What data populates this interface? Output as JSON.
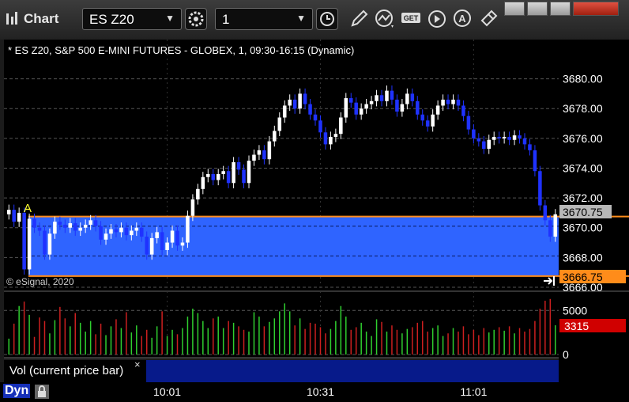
{
  "app_title": "Chart",
  "symbol_field": {
    "value": "ES Z20"
  },
  "interval_field": {
    "value": "1"
  },
  "toolbar_icons": [
    "settings-gear-icon",
    "clock-icon",
    "pencil-icon",
    "study-icon",
    "get-icon",
    "play-icon",
    "alert-icon",
    "link-icon"
  ],
  "window_buttons": [
    "help-icon",
    "restore-icon",
    "maximize-icon",
    "close-icon"
  ],
  "chart_header": "* ES Z20, S&P 500 E-MINI FUTURES - GLOBEX, 1, 09:30-16:15 (Dynamic)",
  "copyright": "© eSignal, 2020",
  "annotation_letter": "A",
  "volume_pane_label": "Vol (current price bar)",
  "volume_close_glyph": "×",
  "bottom_label": "Dyn",
  "price_ticks": [
    "3680.00",
    "3678.00",
    "3676.00",
    "3674.00",
    "3672.00",
    "3670.00",
    "3668.00",
    "3666.00"
  ],
  "volume_ticks": [
    "5000",
    "0"
  ],
  "time_ticks": [
    "10:01",
    "10:31",
    "11:01"
  ],
  "price_badge_upper": "3670.75",
  "price_badge_lower": "3666.75",
  "volume_badge": "3315",
  "colors": {
    "up_candle": "#ffffff",
    "down_candle": "#1f32ff",
    "zone_fill": "#2f64ff",
    "zone_border": "#ff8c1a",
    "volume_up": "#2fcf2f",
    "volume_down": "#cc1f1f",
    "badge_upper": "#b8b8b8",
    "badge_lower": "#ff8c1a",
    "badge_volume": "#d00000"
  },
  "chart_data": {
    "type": "candlestick",
    "title": "* ES Z20, S&P 500 E-MINI FUTURES - GLOBEX, 1, 09:30-16:15 (Dynamic)",
    "ylim": [
      3666,
      3681.2
    ],
    "volume_ylim": [
      0,
      7000
    ],
    "highlight_zone": [
      3666.75,
      3670.75
    ],
    "x_ticks": [
      {
        "label": "10:01",
        "bar_index": 31
      },
      {
        "label": "10:31",
        "bar_index": 61
      },
      {
        "label": "11:01",
        "bar_index": 91
      }
    ],
    "volume_current": 3315,
    "candle_closes": [
      3671.2,
      3670.4,
      3671.0,
      3667.2,
      3670.6,
      3670.0,
      3669.8,
      3668.2,
      3669.6,
      3670.4,
      3670.2,
      3670.0,
      3670.3,
      3669.8,
      3670.0,
      3670.2,
      3670.5,
      3670.1,
      3669.2,
      3669.6,
      3669.9,
      3669.7,
      3670.0,
      3669.5,
      3669.8,
      3670.0,
      3669.4,
      3668.2,
      3669.3,
      3669.7,
      3668.5,
      3669.0,
      3669.8,
      3668.8,
      3669.0,
      3670.8,
      3671.9,
      3672.6,
      3673.4,
      3673.6,
      3673.2,
      3673.6,
      3673.8,
      3673.0,
      3674.4,
      3673.9,
      3673.0,
      3674.5,
      3674.9,
      3675.2,
      3674.6,
      3675.8,
      3676.5,
      3677.4,
      3678.2,
      3678.6,
      3678.0,
      3679.0,
      3678.3,
      3677.6,
      3677.2,
      3676.4,
      3675.6,
      3676.1,
      3676.3,
      3677.4,
      3678.7,
      3678.4,
      3677.6,
      3678.0,
      3678.3,
      3678.5,
      3678.9,
      3678.5,
      3679.2,
      3678.6,
      3677.8,
      3678.3,
      3679.0,
      3678.5,
      3677.6,
      3677.2,
      3676.8,
      3677.6,
      3678.2,
      3678.6,
      3678.3,
      3678.6,
      3678.2,
      3677.5,
      3676.6,
      3676.0,
      3675.8,
      3675.3,
      3675.9,
      3676.1,
      3676.0,
      3676.1,
      3675.9,
      3676.2,
      3676.0,
      3675.6,
      3675.2,
      3673.8,
      3671.5,
      3670.5,
      3669.4,
      3670.9
    ],
    "volume_values": [
      1800,
      3500,
      5500,
      6000,
      4500,
      2000,
      4200,
      3800,
      2400,
      3900,
      5400,
      4100,
      3200,
      4700,
      3600,
      2600,
      3800,
      2300,
      3500,
      2200,
      3200,
      4000,
      3000,
      4800,
      2500,
      3300,
      2100,
      2800,
      1900,
      3200,
      4900,
      2100,
      2800,
      2300,
      3000,
      4300,
      5200,
      4700,
      3800,
      3000,
      4100,
      4300,
      3000,
      3800,
      3600,
      3200,
      2800,
      2600,
      4800,
      4300,
      3200,
      3700,
      4100,
      4900,
      5800,
      4900,
      3300,
      4100,
      2900,
      3600,
      3500,
      3100,
      2400,
      2900,
      3800,
      5500,
      4300,
      2800,
      3100,
      3600,
      2600,
      2100,
      4000,
      3700,
      2600,
      3300,
      2800,
      2400,
      2900,
      3100,
      3600,
      3800,
      2600,
      3000,
      3300,
      2100,
      2400,
      3000,
      2600,
      3200,
      2300,
      2800,
      2200,
      3000,
      2500,
      2800,
      3100,
      2700,
      3200,
      2400,
      3000,
      2600,
      2900,
      3800,
      5200,
      6100,
      6300,
      3315
    ]
  }
}
